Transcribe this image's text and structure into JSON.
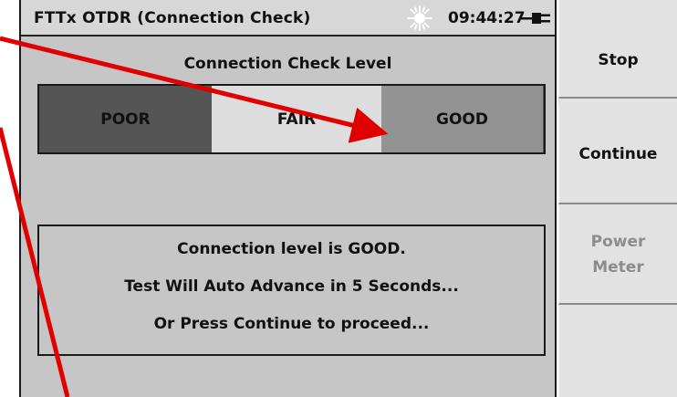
{
  "titlebar": {
    "title": "FTTx OTDR (Connection Check)",
    "time": "09:44:27",
    "status_icon": "sun-icon",
    "power_icon": "ac-power-plug-icon"
  },
  "level": {
    "heading": "Connection Check Level",
    "segments": [
      {
        "label": "POOR"
      },
      {
        "label": "FAIR"
      },
      {
        "label": "GOOD"
      }
    ],
    "current": "GOOD"
  },
  "message": {
    "line1": "Connection level is GOOD.",
    "line2": "Test Will Auto Advance in 5 Seconds...",
    "line3": "Or Press Continue to proceed..."
  },
  "softkeys": {
    "stop": "Stop",
    "continue": "Continue",
    "power_meter": "Power\nMeter",
    "blank": ""
  },
  "colors": {
    "annotation": "#e00000",
    "screen_bg": "#c6c6c6",
    "poor": "#555555",
    "fair": "#dddddd",
    "good": "#939393"
  }
}
